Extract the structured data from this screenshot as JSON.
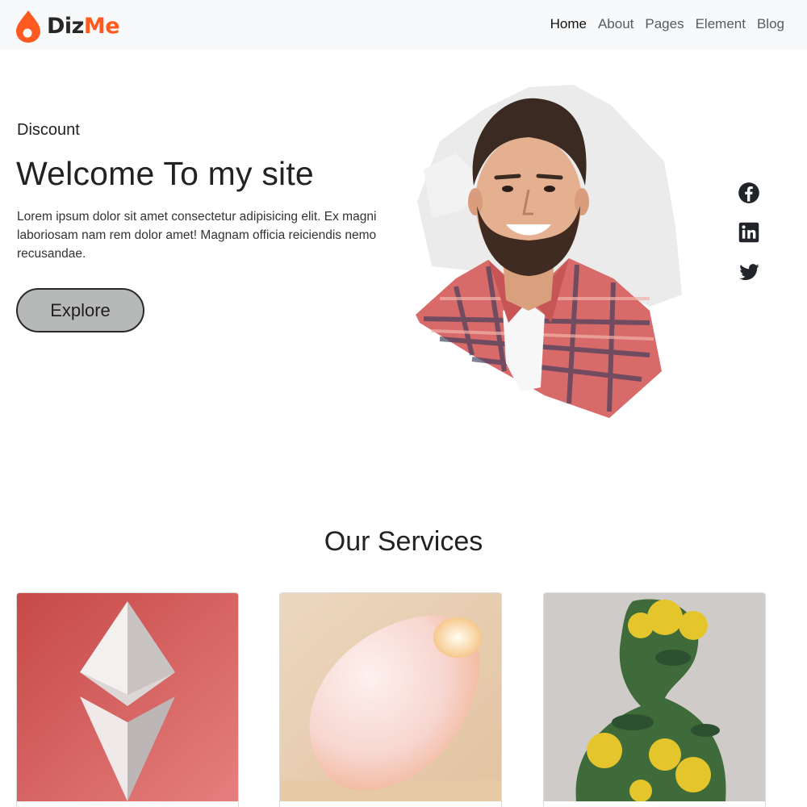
{
  "brand": {
    "name_part1": "Diz",
    "name_part2": "Me",
    "accent_color": "#ff5a1f",
    "icon": "drop-logo-icon"
  },
  "nav": {
    "items": [
      {
        "label": "Home",
        "active": true
      },
      {
        "label": "About",
        "active": false
      },
      {
        "label": "Pages",
        "active": false
      },
      {
        "label": "Element",
        "active": false
      },
      {
        "label": "Blog",
        "active": false
      }
    ]
  },
  "hero": {
    "eyebrow": "Discount",
    "title": "Welcome To my site",
    "text": "Lorem ipsum dolor sit amet consectetur adipisicing elit. Ex magni laboriosam nam rem dolor amet! Magnam officia reiciendis nemo recusandae.",
    "button_label": "Explore",
    "image": "portrait-of-smiling-man-in-plaid-shirt"
  },
  "socials": [
    {
      "name": "facebook-icon"
    },
    {
      "name": "linkedin-icon"
    },
    {
      "name": "twitter-icon"
    }
  ],
  "services": {
    "title": "Our Services",
    "cards": [
      {
        "image": "ethereum-crystal-on-red-background"
      },
      {
        "image": "pink-egg-lamp-on-beige-background"
      },
      {
        "image": "floral-human-bust-sculpture"
      }
    ]
  }
}
